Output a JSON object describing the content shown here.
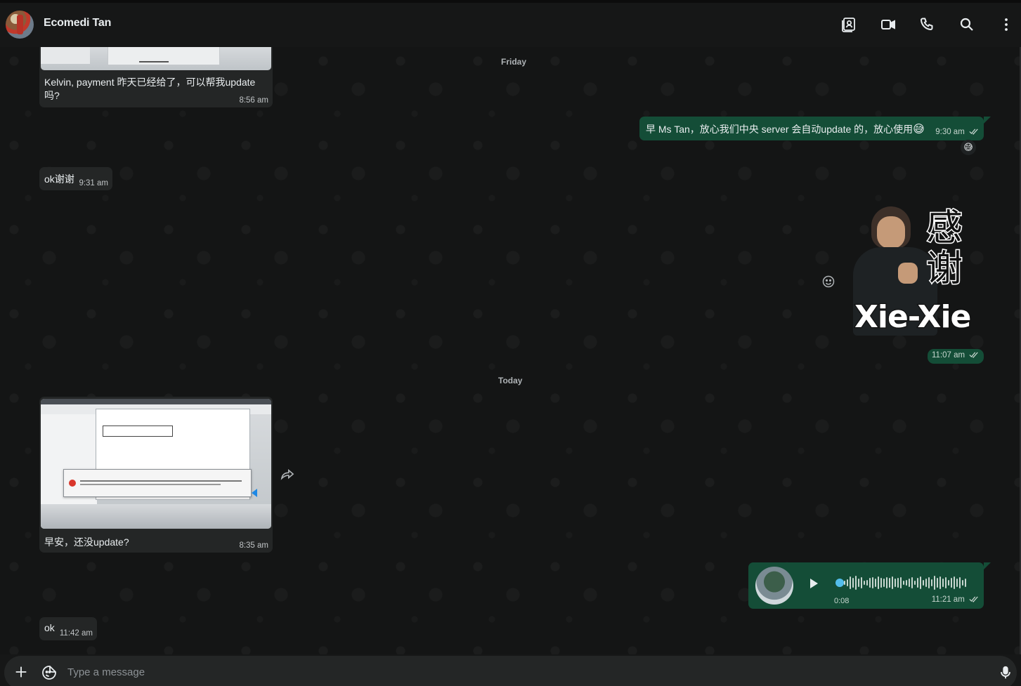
{
  "header": {
    "contact_name": "Ecomedi Tan",
    "icons": [
      "contact-card-icon",
      "video-call-icon",
      "voice-call-icon",
      "search-icon",
      "more-options-icon"
    ]
  },
  "day_chips": {
    "friday": "Friday",
    "today": "Today"
  },
  "messages": {
    "m1": {
      "text": "Kelvin, payment 昨天已经给了，可以帮我update吗?",
      "time": "8:56 am"
    },
    "m2": {
      "text": "早 Ms Tan，放心我们中央 server 会自动update 的，放心使用",
      "time": "9:30 am",
      "emoji": "😅",
      "reaction": "😅"
    },
    "m3": {
      "text": "ok谢谢",
      "time": "9:31 am"
    },
    "m4": {
      "sticker_text": "Xie-Xie",
      "sticker_chars": "感谢",
      "time": "11:07 am"
    },
    "m5": {
      "text": "早安，还没update?",
      "time": "8:35 am"
    },
    "m6": {
      "duration": "0:08",
      "time": "11:21 am"
    },
    "m7": {
      "text": "ok",
      "time": "11:42 am"
    }
  },
  "composer": {
    "placeholder": "Type a message"
  },
  "colors": {
    "background": "#161717",
    "incoming_bubble": "#242626",
    "outgoing_bubble": "#144d37",
    "accent": "#53bdeb"
  }
}
